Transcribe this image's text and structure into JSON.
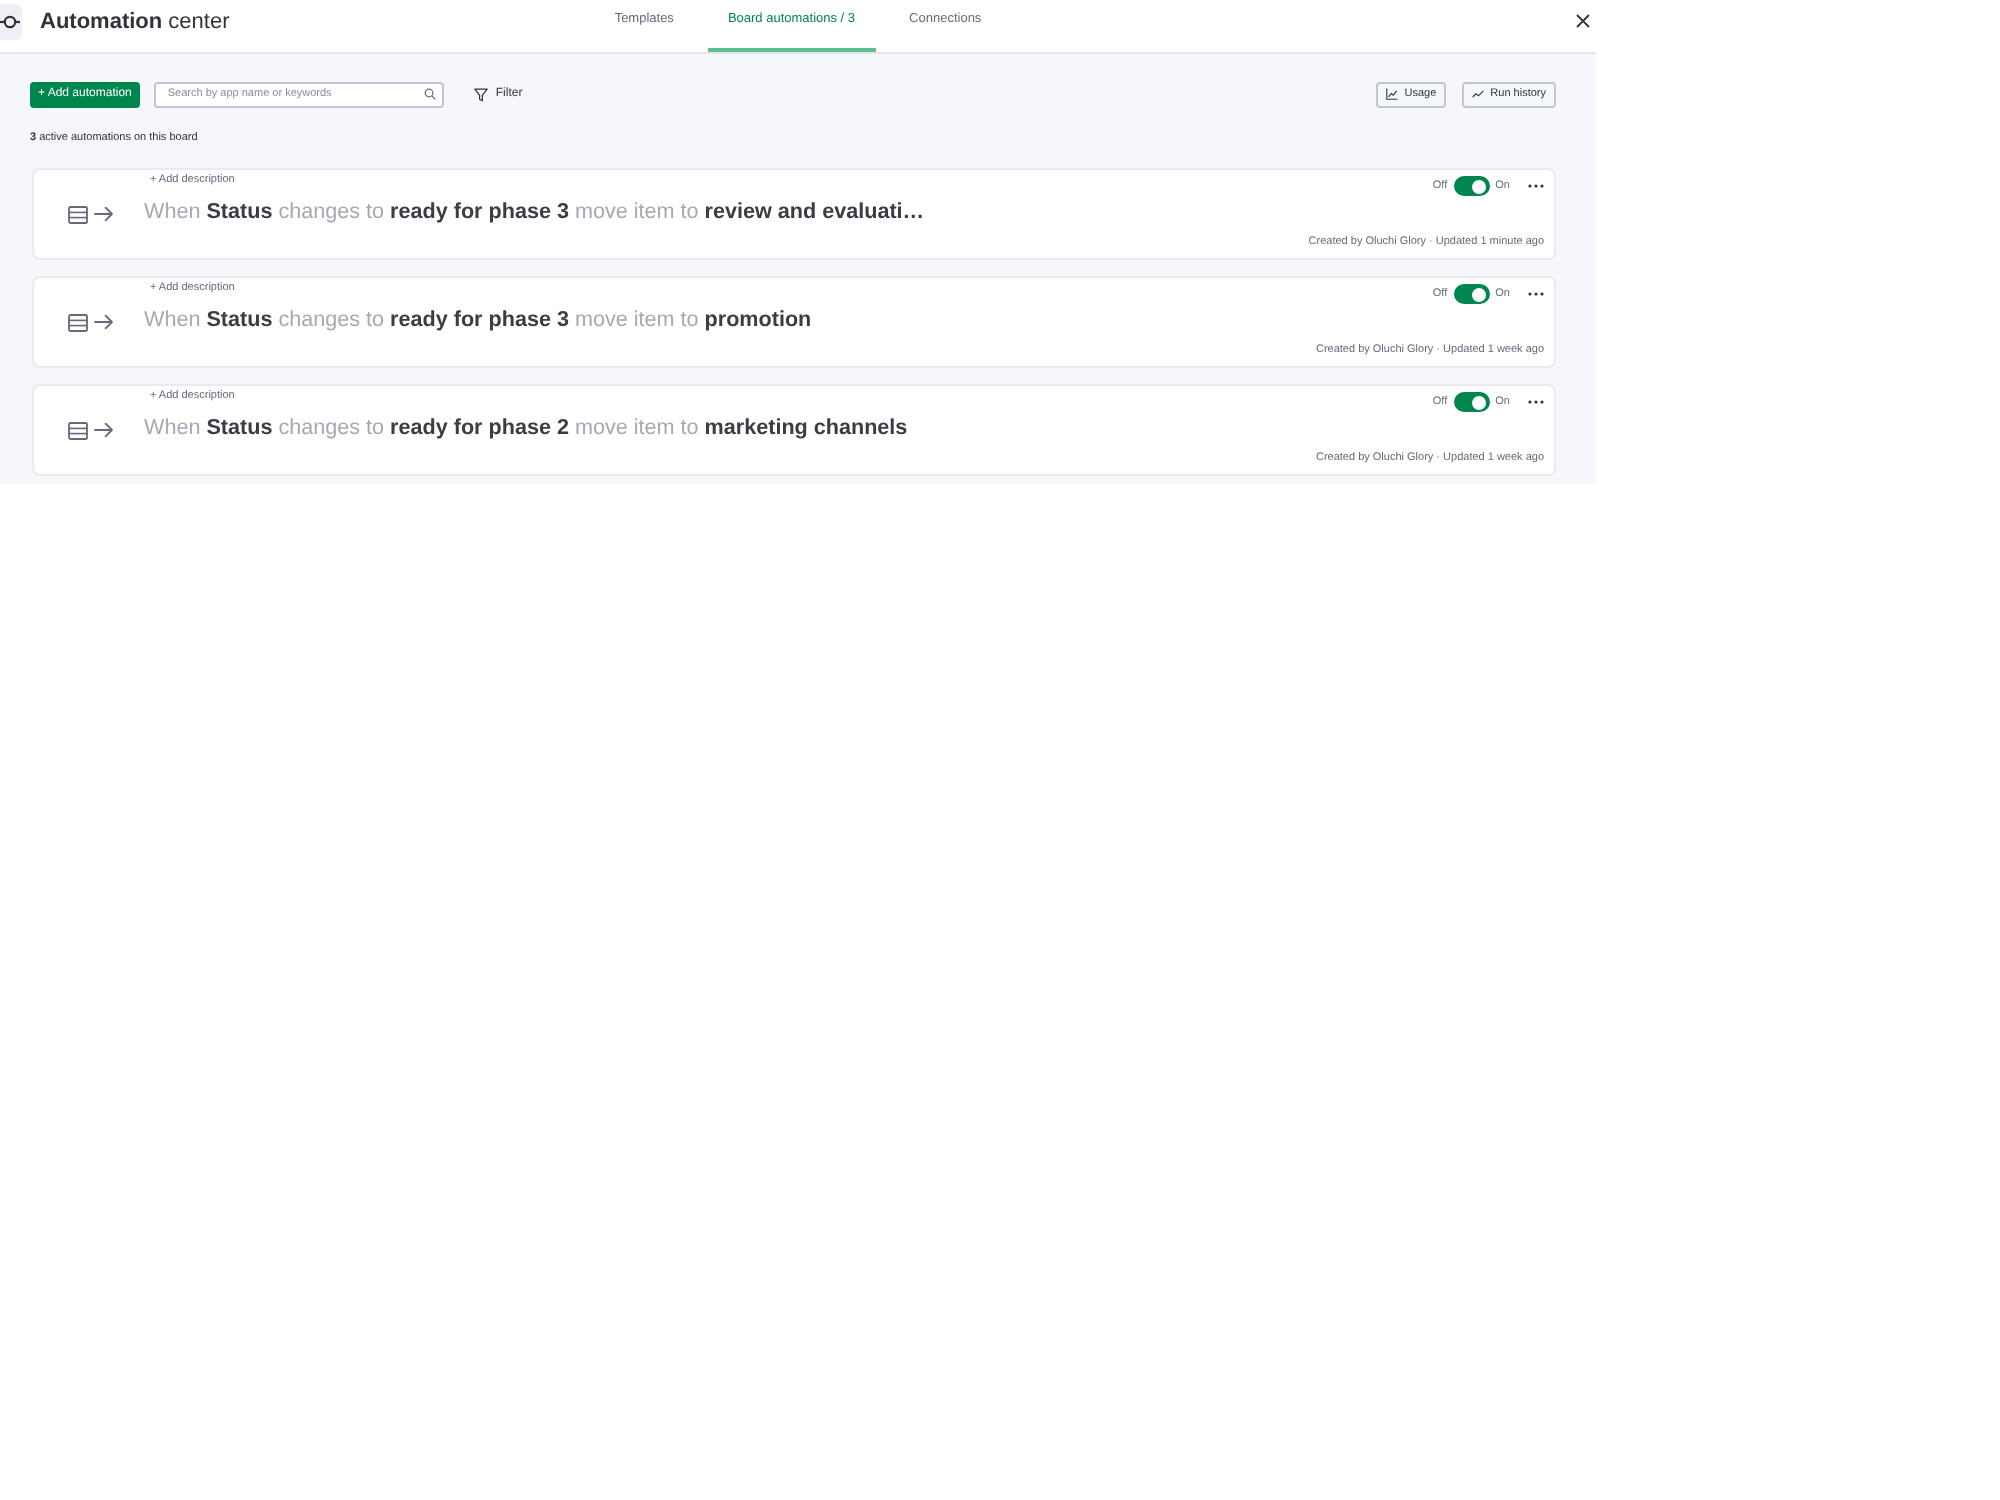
{
  "header": {
    "title": "**Automation** center"
  },
  "tabs": [
    {
      "label": "Templates",
      "selected": false
    },
    {
      "label": "Board automations / 3",
      "selected": true
    },
    {
      "label": "Connections",
      "selected": false
    }
  ],
  "toolbar": {
    "add_button": "+ Add automation",
    "search": {
      "placeholder": "Search by app name or keywords"
    },
    "filter": "Filter",
    "usage_button": "Usage",
    "run_history_button": "Run history"
  },
  "summary": "**3** active automations on this board",
  "automations": [
    {
      "add_description": "+ Add description",
      "sentence": "When **Status** changes to **ready for phase 3** move item to **review and evaluati…**",
      "off_label": "Off",
      "on": true,
      "on_label": "On",
      "footer": "Created by Oluchi Glory · Updated 1 minute ago"
    },
    {
      "add_description": "+ Add description",
      "sentence": "When **Status** changes to **ready for phase 3** move item to **promotion**",
      "off_label": "Off",
      "on": true,
      "on_label": "On",
      "footer": "Created by Oluchi Glory · Updated 1 week ago"
    },
    {
      "add_description": "+ Add description",
      "sentence": "When **Status** changes to **ready for phase 2** move item to **marketing channels**",
      "off_label": "Off",
      "on": true,
      "on_label": "On",
      "footer": "Created by Oluchi Glory · Updated 1 week ago"
    }
  ]
}
